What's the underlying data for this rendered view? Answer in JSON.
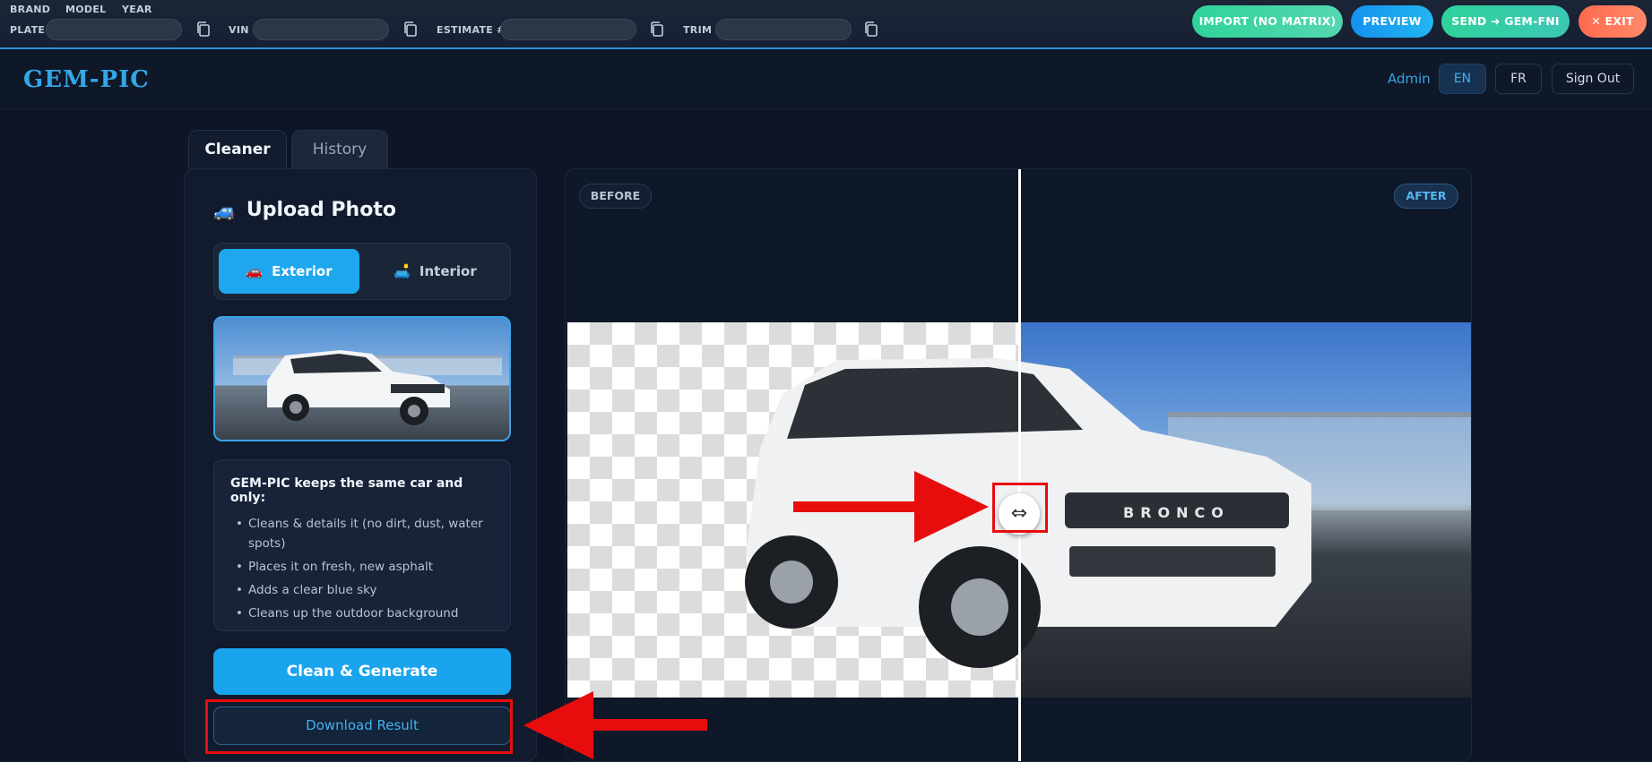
{
  "topbar": {
    "brand_label": "BRAND",
    "model_label": "MODEL",
    "year_label": "YEAR",
    "plate_label": "PLATE",
    "vin_label": "VIN",
    "estimate_label": "ESTIMATE #",
    "trim_label": "TRIM",
    "plate_value": "",
    "vin_value": "",
    "estimate_value": "",
    "trim_value": "",
    "buttons": {
      "import": "IMPORT (NO MATRIX)",
      "preview": "PREVIEW",
      "send": "SEND ➜ GEM-FNI",
      "exit": "✕ EXIT"
    }
  },
  "header": {
    "logo": "GEM-PIC",
    "user": "Admin",
    "lang_en": "EN",
    "lang_fr": "FR",
    "sign_out": "Sign Out"
  },
  "tabs": [
    "Cleaner",
    "History"
  ],
  "upload": {
    "icon": "🚙",
    "title": "Upload Photo",
    "exterior": {
      "icon": "🚗",
      "label": "Exterior"
    },
    "interior": {
      "icon": "🛋️",
      "label": "Interior"
    }
  },
  "info": {
    "heading": "GEM-PIC keeps the same car and only:",
    "items": [
      "Cleans & details it (no dirt, dust, water spots)",
      "Places it on fresh, new asphalt",
      "Adds a clear blue sky",
      "Cleans up the outdoor background"
    ]
  },
  "actions": {
    "generate": "Clean & Generate",
    "download": "Download Result"
  },
  "compare": {
    "before": "BEFORE",
    "after": "AFTER",
    "handle_glyph": "⇔",
    "vehicle_badge_text": "BRONCO"
  },
  "colors": {
    "accent": "#1aa4ee",
    "annotation": "#e80d0d"
  }
}
